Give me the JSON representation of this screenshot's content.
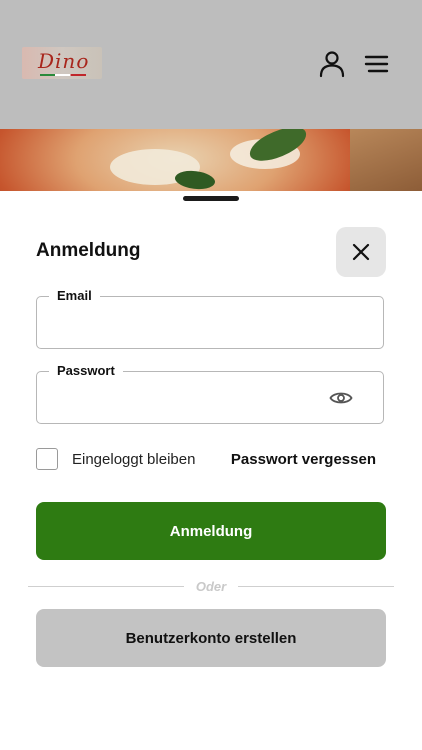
{
  "header": {
    "logo_text": "Dino",
    "user_icon": "user-icon",
    "menu_icon": "hamburger-menu-icon"
  },
  "login": {
    "title": "Anmeldung",
    "close_icon": "close-icon",
    "email": {
      "label": "Email",
      "value": "",
      "placeholder": ""
    },
    "password": {
      "label": "Passwort",
      "value": "",
      "placeholder": "",
      "toggle_icon": "eye-icon"
    },
    "remember_label": "Eingeloggt bleiben",
    "remember_checked": false,
    "forgot_label": "Passwort vergessen",
    "submit_label": "Anmeldung",
    "divider_text": "Oder",
    "register_label": "Benutzerkonto erstellen"
  },
  "colors": {
    "primary": "#2e7b12",
    "secondary": "#c3c3c3",
    "overlay": "#bdbdbd"
  }
}
